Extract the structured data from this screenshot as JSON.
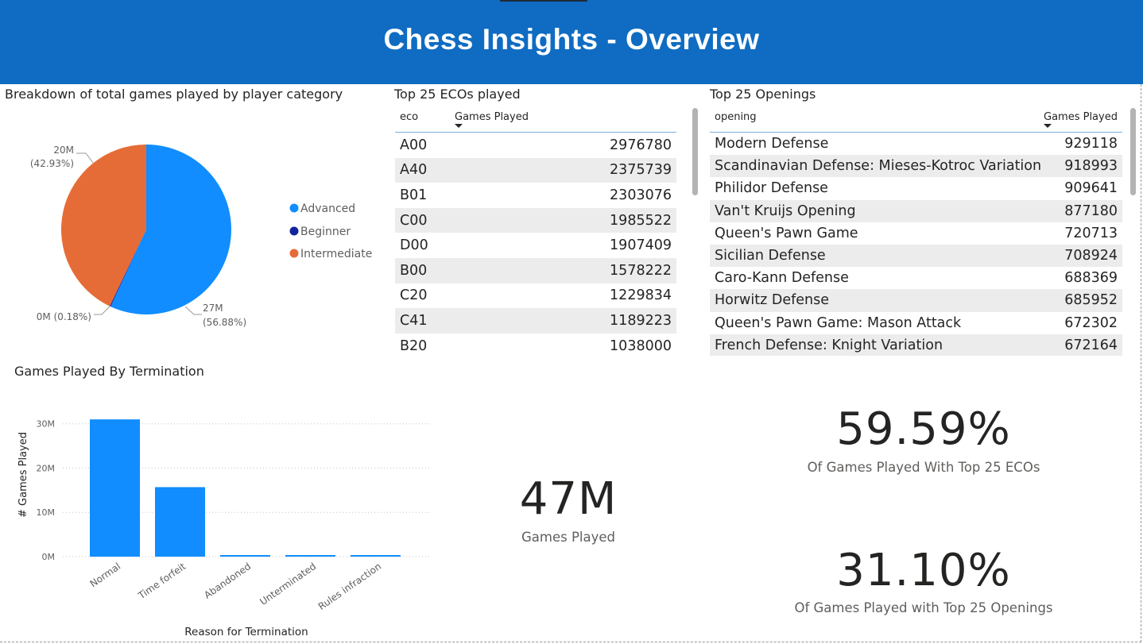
{
  "header": {
    "title": "Chess Insights - Overview",
    "color": "#0f6cc2"
  },
  "pie_chart": {
    "title": "Breakdown of total games played by player category",
    "legend": [
      {
        "label": "Advanced",
        "color": "#118dff"
      },
      {
        "label": "Beginner",
        "color": "#12239e"
      },
      {
        "label": "Intermediate",
        "color": "#e66c37"
      }
    ],
    "labels": {
      "advanced_value": "27M",
      "advanced_pct": "(56.88%)",
      "beginner": "0M (0.18%)",
      "intermediate_value": "20M",
      "intermediate_pct": "(42.93%)"
    },
    "chart_data": {
      "type": "pie",
      "categories": [
        "Advanced",
        "Beginner",
        "Intermediate"
      ],
      "values": [
        56.88,
        0.18,
        42.93
      ],
      "colors": [
        "#118dff",
        "#12239e",
        "#e66c37"
      ],
      "legend_position": "right"
    }
  },
  "eco_table": {
    "title": "Top 25 ECOs played",
    "columns": [
      "eco",
      "Games Played"
    ],
    "rows": [
      [
        "A00",
        "2976780"
      ],
      [
        "A40",
        "2375739"
      ],
      [
        "B01",
        "2303076"
      ],
      [
        "C00",
        "1985522"
      ],
      [
        "D00",
        "1907409"
      ],
      [
        "B00",
        "1578222"
      ],
      [
        "C20",
        "1229834"
      ],
      [
        "C41",
        "1189223"
      ],
      [
        "B20",
        "1038000"
      ]
    ]
  },
  "openings_table": {
    "title": "Top 25 Openings",
    "columns": [
      "opening",
      "Games Played"
    ],
    "rows": [
      [
        "Modern Defense",
        "929118"
      ],
      [
        "Scandinavian Defense: Mieses-Kotroc Variation",
        "918993"
      ],
      [
        "Philidor Defense",
        "909641"
      ],
      [
        "Van't Kruijs Opening",
        "877180"
      ],
      [
        "Queen's Pawn Game",
        "720713"
      ],
      [
        "Sicilian Defense",
        "708924"
      ],
      [
        "Caro-Kann Defense",
        "688369"
      ],
      [
        "Horwitz Defense",
        "685952"
      ],
      [
        "Queen's Pawn Game: Mason Attack",
        "672302"
      ],
      [
        "French Defense: Knight Variation",
        "672164"
      ]
    ]
  },
  "bar_chart": {
    "title": "Games Played By Termination",
    "color": "#118dff",
    "chart_data": {
      "type": "bar",
      "categories": [
        "Normal",
        "Time forfeit",
        "Abandoned",
        "Unterminated",
        "Rules infraction"
      ],
      "values": [
        31.0,
        15.7,
        0.15,
        0.1,
        0.1
      ],
      "ylim": [
        0,
        33
      ],
      "yticks": [
        "0M",
        "10M",
        "20M",
        "30M"
      ],
      "ytick_values": [
        0,
        10,
        20,
        30
      ],
      "xlabel": "Reason for Termination",
      "ylabel": "# Games Played",
      "grid": true
    }
  },
  "cards": {
    "total": {
      "value": "47M",
      "label": "Games Played"
    },
    "eco_pct": {
      "value": "59.59%",
      "label": "Of Games Played With Top 25 ECOs"
    },
    "opening_pct": {
      "value": "31.10%",
      "label": "Of Games Played with Top 25 Openings"
    }
  }
}
